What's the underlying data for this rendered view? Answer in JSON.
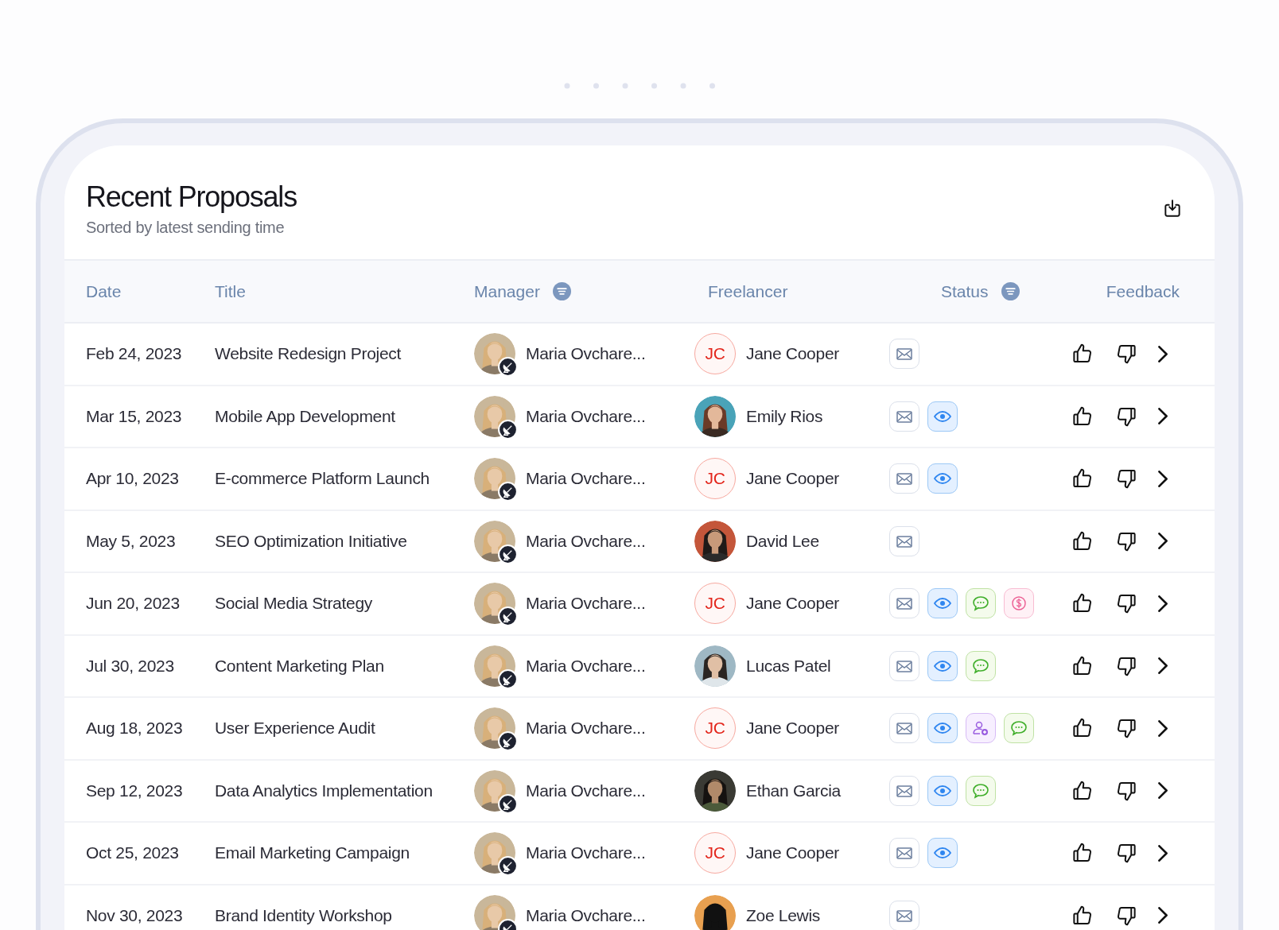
{
  "header": {
    "title": "Recent Proposals",
    "subtitle": "Sorted by latest sending time"
  },
  "columns": [
    {
      "label": "Date",
      "filterable": false
    },
    {
      "label": "Title",
      "filterable": false
    },
    {
      "label": "Manager",
      "filterable": true
    },
    {
      "label": "Freelancer",
      "filterable": false
    },
    {
      "label": "Status",
      "filterable": true
    },
    {
      "label": "Feedback",
      "filterable": false
    }
  ],
  "rows": [
    {
      "date": "Feb 24, 2023",
      "title": "Website Redesign Project",
      "manager": "Maria Ovchare...",
      "freelancer": {
        "kind": "initials",
        "initials": "JC",
        "name": "Jane Cooper"
      },
      "status": [
        {
          "kind": "mail"
        }
      ]
    },
    {
      "date": "Mar 15, 2023",
      "title": "Mobile App Development",
      "manager": "Maria Ovchare...",
      "freelancer": {
        "kind": "picture",
        "name": "Emily Rios"
      },
      "status": [
        {
          "kind": "mail"
        },
        {
          "kind": "eye"
        }
      ]
    },
    {
      "date": "Apr 10, 2023",
      "title": "E-commerce Platform Launch",
      "manager": "Maria Ovchare...",
      "freelancer": {
        "kind": "initials",
        "initials": "JC",
        "name": "Jane Cooper"
      },
      "status": [
        {
          "kind": "mail"
        },
        {
          "kind": "eye"
        }
      ]
    },
    {
      "date": "May 5, 2023",
      "title": "SEO Optimization Initiative",
      "manager": "Maria Ovchare...",
      "freelancer": {
        "kind": "picture",
        "name": "David Lee"
      },
      "status": [
        {
          "kind": "mail"
        }
      ]
    },
    {
      "date": "Jun 20, 2023",
      "title": "Social Media Strategy",
      "manager": "Maria Ovchare...",
      "freelancer": {
        "kind": "initials",
        "initials": "JC",
        "name": "Jane Cooper"
      },
      "status": [
        {
          "kind": "mail"
        },
        {
          "kind": "eye"
        },
        {
          "kind": "chat"
        },
        {
          "kind": "dollar"
        }
      ]
    },
    {
      "date": "Jul 30, 2023",
      "title": "Content Marketing Plan",
      "manager": "Maria Ovchare...",
      "freelancer": {
        "kind": "picture",
        "name": "Lucas Patel"
      },
      "status": [
        {
          "kind": "mail"
        },
        {
          "kind": "eye"
        },
        {
          "kind": "chat"
        }
      ]
    },
    {
      "date": "Aug 18, 2023",
      "title": "User Experience Audit",
      "manager": "Maria Ovchare...",
      "freelancer": {
        "kind": "initials",
        "initials": "JC",
        "name": "Jane Cooper"
      },
      "status": [
        {
          "kind": "mail"
        },
        {
          "kind": "eye"
        },
        {
          "kind": "user-add"
        },
        {
          "kind": "chat"
        }
      ]
    },
    {
      "date": "Sep 12, 2023",
      "title": "Data Analytics Implementation",
      "manager": "Maria Ovchare...",
      "freelancer": {
        "kind": "picture",
        "name": "Ethan Garcia"
      },
      "status": [
        {
          "kind": "mail"
        },
        {
          "kind": "eye"
        },
        {
          "kind": "chat"
        }
      ]
    },
    {
      "date": "Oct 25, 2023",
      "title": "Email Marketing Campaign",
      "manager": "Maria Ovchare...",
      "freelancer": {
        "kind": "initials",
        "initials": "JC",
        "name": "Jane Cooper"
      },
      "status": [
        {
          "kind": "mail"
        },
        {
          "kind": "eye"
        }
      ]
    },
    {
      "date": "Nov 30, 2023",
      "title": "Brand Identity Workshop",
      "manager": "Maria Ovchare...",
      "freelancer": {
        "kind": "picture",
        "name": "Zoe Lewis"
      },
      "status": [
        {
          "kind": "mail"
        }
      ]
    }
  ]
}
